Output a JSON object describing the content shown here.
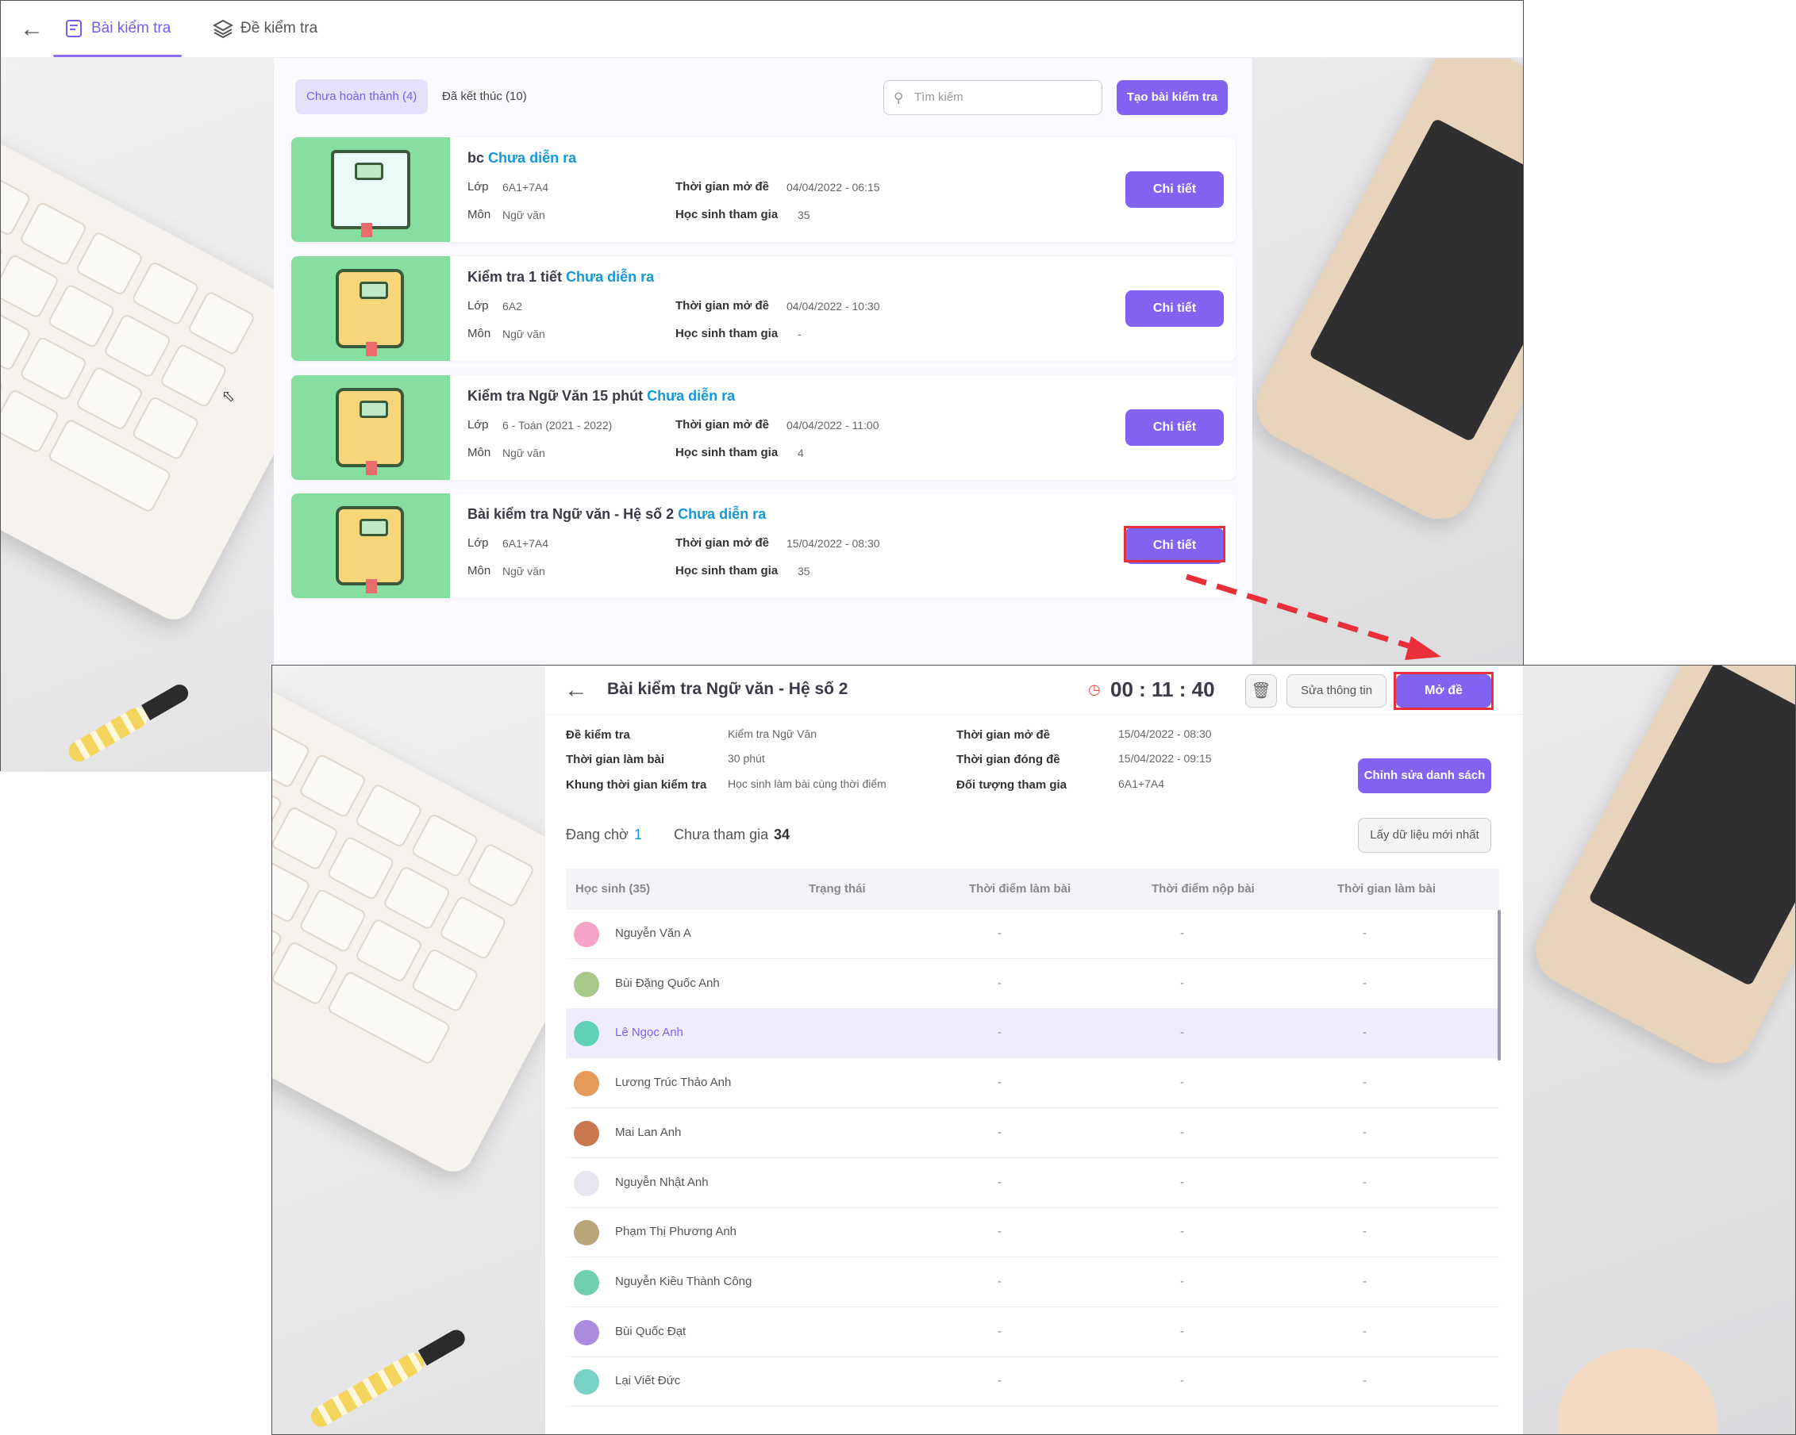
{
  "list_screen": {
    "tabs": [
      {
        "label": "Bài kiểm tra",
        "active": true
      },
      {
        "label": "Đề kiểm tra",
        "active": false
      }
    ],
    "filters": {
      "incomplete": "Chưa hoàn thành (4)",
      "finished": "Đã kết thúc (10)"
    },
    "search": {
      "placeholder": "Tìm kiếm"
    },
    "create_button": "Tạo bài kiểm tra",
    "field_labels": {
      "class": "Lớp",
      "subject": "Môn",
      "open_time": "Thời gian mở đề",
      "participants": "Học sinh tham gia"
    },
    "cards": [
      {
        "name": "bc",
        "status": "Chưa diễn ra",
        "class": "6A1+7A4",
        "subject": "Ngữ văn",
        "open_time": "04/04/2022 - 06:15",
        "participants": "35",
        "button": "Chi tiết",
        "thumb": "open-book-icon"
      },
      {
        "name": "Kiểm tra 1 tiết",
        "status": "Chưa diễn ra",
        "class": "6A2",
        "subject": "Ngữ văn",
        "open_time": "04/04/2022 - 10:30",
        "participants": "-",
        "button": "Chi tiết",
        "thumb": "notebook-icon"
      },
      {
        "name": "Kiểm tra Ngữ Văn 15 phút",
        "status": "Chưa diễn ra",
        "class": "6 - Toán (2021 - 2022)",
        "subject": "Ngữ văn",
        "open_time": "04/04/2022 - 11:00",
        "participants": "4",
        "button": "Chi tiết",
        "thumb": "notebook-icon"
      },
      {
        "name": "Bài kiểm tra Ngữ văn - Hệ số 2",
        "status": "Chưa diễn ra",
        "class": "6A1+7A4",
        "subject": "Ngữ văn",
        "open_time": "15/04/2022 - 08:30",
        "participants": "35",
        "button": "Chi tiết",
        "thumb": "notebook-icon"
      }
    ]
  },
  "detail_screen": {
    "title": "Bài kiểm tra Ngữ văn - Hệ số 2",
    "timer": "00 : 11 : 40",
    "edit_info_button": "Sửa thông tin",
    "open_exam_button": "Mở đề",
    "info": {
      "exam_label": "Đề kiểm tra",
      "exam_value": "Kiểm tra Ngữ Văn",
      "duration_label": "Thời gian làm bài",
      "duration_value": "30 phút",
      "frame_label": "Khung thời gian kiểm tra",
      "frame_value": "Học sinh làm bài cùng thời điểm",
      "open_label": "Thời gian mở đề",
      "open_value": "15/04/2022 - 08:30",
      "close_label": "Thời gian đóng đề",
      "close_value": "15/04/2022 - 09:15",
      "target_label": "Đối tượng tham gia",
      "target_value": "6A1+7A4"
    },
    "edit_list_button": "Chỉnh sửa danh sách",
    "refresh_button": "Lấy dữ liệu mới nhất",
    "waiting_label": "Đang chờ",
    "waiting_count": "1",
    "absent_label": "Chưa tham gia",
    "absent_count": "34",
    "columns": [
      "Học sinh (35)",
      "Trạng thái",
      "Thời điểm làm bài",
      "Thời điểm nộp bài",
      "Thời gian làm bài"
    ],
    "students": [
      {
        "name": "Nguyễn Văn A",
        "avatar_color": "#f5a3c7"
      },
      {
        "name": "Bùi Đặng Quốc Anh",
        "avatar_color": "#a8c98a"
      },
      {
        "name": "Lê Ngọc Anh",
        "avatar_color": "#5fd1b8",
        "highlight": true
      },
      {
        "name": "Lương Trúc Thảo Anh",
        "avatar_color": "#e69a5a"
      },
      {
        "name": "Mai Lan Anh",
        "avatar_color": "#c9774f"
      },
      {
        "name": "Nguyễn Nhật Anh",
        "avatar_color": "#e6e6ee"
      },
      {
        "name": "Phạm Thị Phương Anh",
        "avatar_color": "#b9a57a"
      },
      {
        "name": "Nguyễn Kiều Thành Công",
        "avatar_color": "#6fcfae"
      },
      {
        "name": "Bùi Quốc Đạt",
        "avatar_color": "#a98be0"
      },
      {
        "name": "Lại Viết Đức",
        "avatar_color": "#79d3c5"
      }
    ],
    "empty_cell": "-"
  },
  "colors": {
    "accent": "#8262f1",
    "status": "#1598d9",
    "highlight_row": "#efecfd",
    "annotation": "#e9303a"
  }
}
